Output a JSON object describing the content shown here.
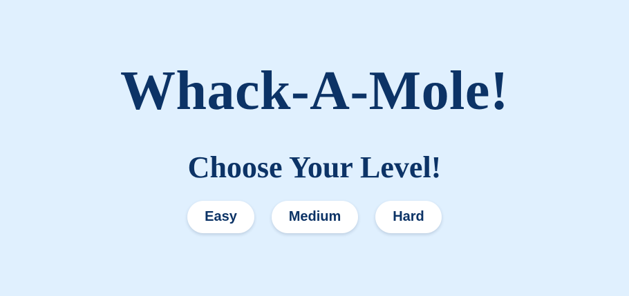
{
  "title": "Whack-A-Mole!",
  "subtitle": "Choose Your Level!",
  "levels": [
    {
      "label": "Easy"
    },
    {
      "label": "Medium"
    },
    {
      "label": "Hard"
    }
  ],
  "colors": {
    "background": "#e0f0fe",
    "text": "#0c3366",
    "button_background": "#ffffff"
  }
}
